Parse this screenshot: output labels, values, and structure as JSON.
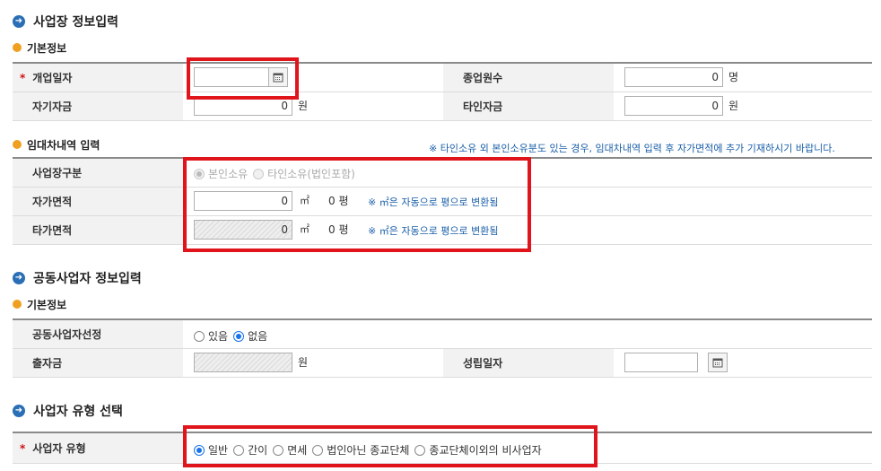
{
  "sections": {
    "business_info": {
      "title": "사업장 정보입력"
    },
    "basic_info": {
      "title": "기본정보"
    },
    "lease_info": {
      "title": "임대차내역 입력",
      "note": "※ 타인소유 외 본인소유분도 있는 경우, 임대차내역 입력 후 자가면적에 추가 기재하시기 바랍니다."
    },
    "partner_info": {
      "title": "공동사업자 정보입력"
    },
    "partner_basic": {
      "title": "기본정보"
    },
    "biz_type": {
      "title": "사업자 유형 선택"
    }
  },
  "business": {
    "open_date": {
      "label": "개업일자",
      "value": ""
    },
    "employees": {
      "label": "종업원수",
      "value": "0",
      "unit": "명"
    },
    "own_capital": {
      "label": "자기자금",
      "value": "0",
      "unit": "원"
    },
    "other_capital": {
      "label": "타인자금",
      "value": "0",
      "unit": "원"
    },
    "required_mark": "*"
  },
  "lease": {
    "site_type": {
      "label": "사업장구분",
      "options": [
        "본인소유",
        "타인소유(법인포함)"
      ],
      "selected": "본인소유"
    },
    "own_area": {
      "label": "자가면적",
      "value": "0",
      "unit": "㎡",
      "pyeong": "0 평",
      "note": "※ ㎡은 자동으로 평으로 변환됨"
    },
    "other_area": {
      "label": "타가면적",
      "value": "0",
      "unit": "㎡",
      "pyeong": "0 평",
      "note": "※ ㎡은 자동으로 평으로 변환됨"
    }
  },
  "partner": {
    "select": {
      "label": "공동사업자선정",
      "options": [
        "있음",
        "없음"
      ],
      "selected": "없음"
    },
    "investment": {
      "label": "출자금",
      "value": "",
      "unit": "원"
    },
    "established": {
      "label": "성립일자",
      "value": ""
    }
  },
  "biz_type": {
    "label": "사업자 유형",
    "required_mark": "*",
    "options": [
      "일반",
      "간이",
      "면세",
      "법인아닌 종교단체",
      "종교단체이외의 비사업자"
    ],
    "selected": "일반"
  },
  "colors": {
    "highlight": "#e0151b",
    "accent": "#1a73e8",
    "section_icon": "#2a6fb5",
    "sub_icon": "#f0a020"
  }
}
